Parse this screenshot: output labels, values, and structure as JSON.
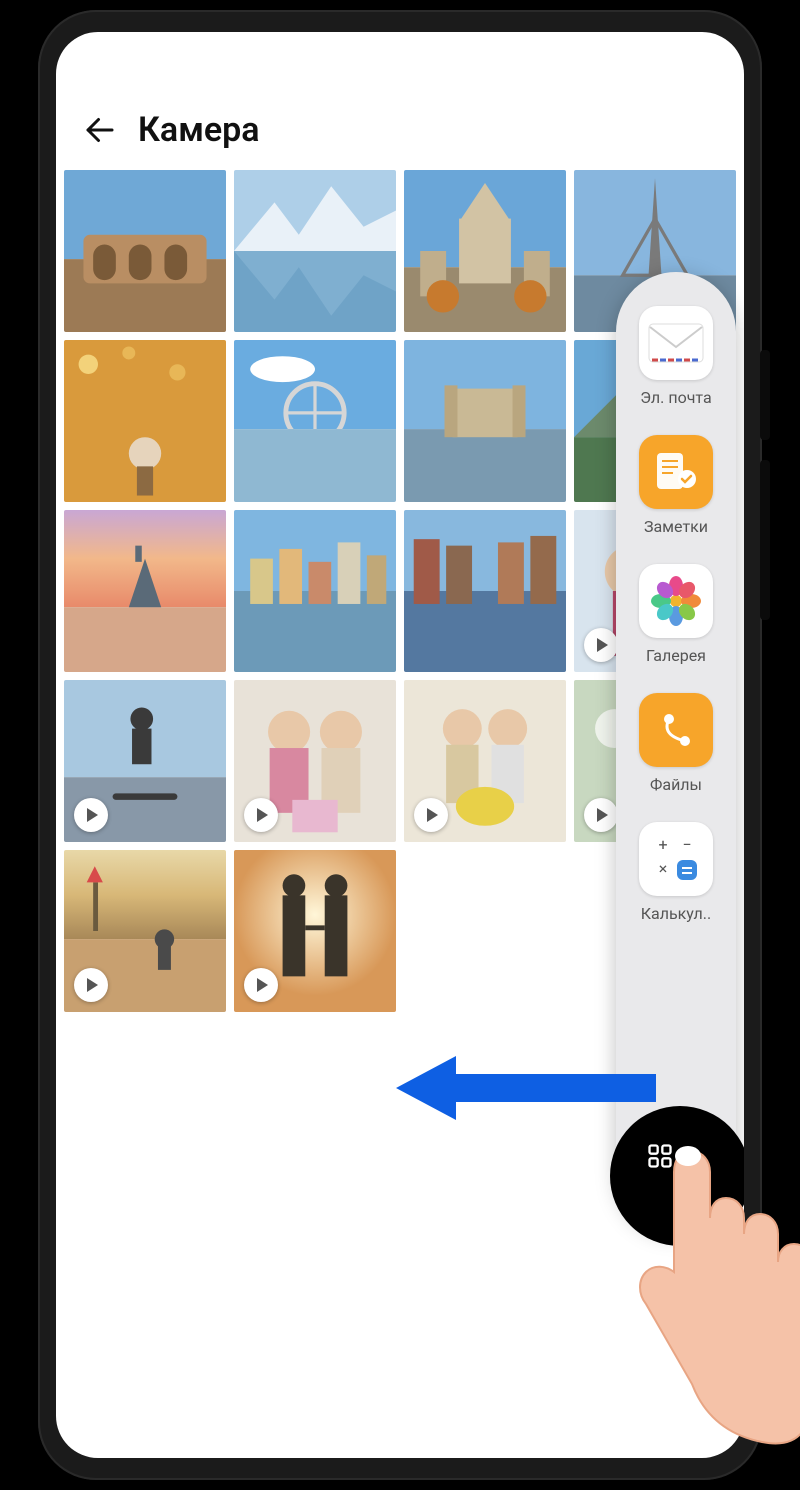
{
  "header": {
    "title": "Камера",
    "back_icon": "arrow-left"
  },
  "grid": {
    "columns": 4,
    "items": [
      {
        "kind": "photo",
        "scene": "colosseum",
        "video": false
      },
      {
        "kind": "photo",
        "scene": "mountain-lake",
        "video": false
      },
      {
        "kind": "photo",
        "scene": "cathedral",
        "video": false
      },
      {
        "kind": "photo",
        "scene": "eiffel",
        "video": false
      },
      {
        "kind": "photo",
        "scene": "autumn-child",
        "video": false
      },
      {
        "kind": "photo",
        "scene": "ferris-wheel",
        "video": false
      },
      {
        "kind": "photo",
        "scene": "notre-dame",
        "video": false
      },
      {
        "kind": "photo",
        "scene": "hiker",
        "video": false
      },
      {
        "kind": "photo",
        "scene": "island-sunset",
        "video": false
      },
      {
        "kind": "photo",
        "scene": "city-harbor",
        "video": false
      },
      {
        "kind": "photo",
        "scene": "canal",
        "video": false
      },
      {
        "kind": "photo",
        "scene": "friends",
        "video": true
      },
      {
        "kind": "photo",
        "scene": "skateboard",
        "video": true
      },
      {
        "kind": "photo",
        "scene": "women-gift",
        "video": true
      },
      {
        "kind": "photo",
        "scene": "women-tulips",
        "video": true
      },
      {
        "kind": "photo",
        "scene": "tree-bokeh",
        "video": true
      },
      {
        "kind": "photo",
        "scene": "beach-kid",
        "video": true
      },
      {
        "kind": "photo",
        "scene": "couple-sunset",
        "video": true
      }
    ]
  },
  "dock": {
    "items": [
      {
        "id": "email",
        "label": "Эл. почта",
        "icon": "mail"
      },
      {
        "id": "notes",
        "label": "Заметки",
        "icon": "notes"
      },
      {
        "id": "gallery",
        "label": "Галерея",
        "icon": "flower"
      },
      {
        "id": "files",
        "label": "Файлы",
        "icon": "files"
      },
      {
        "id": "calculator",
        "label": "Калькул..",
        "icon": "calculator"
      }
    ],
    "add_icon": "plus",
    "grid_icon": "apps"
  },
  "gesture": {
    "direction": "left",
    "arrow_color": "#0e5fe3"
  }
}
